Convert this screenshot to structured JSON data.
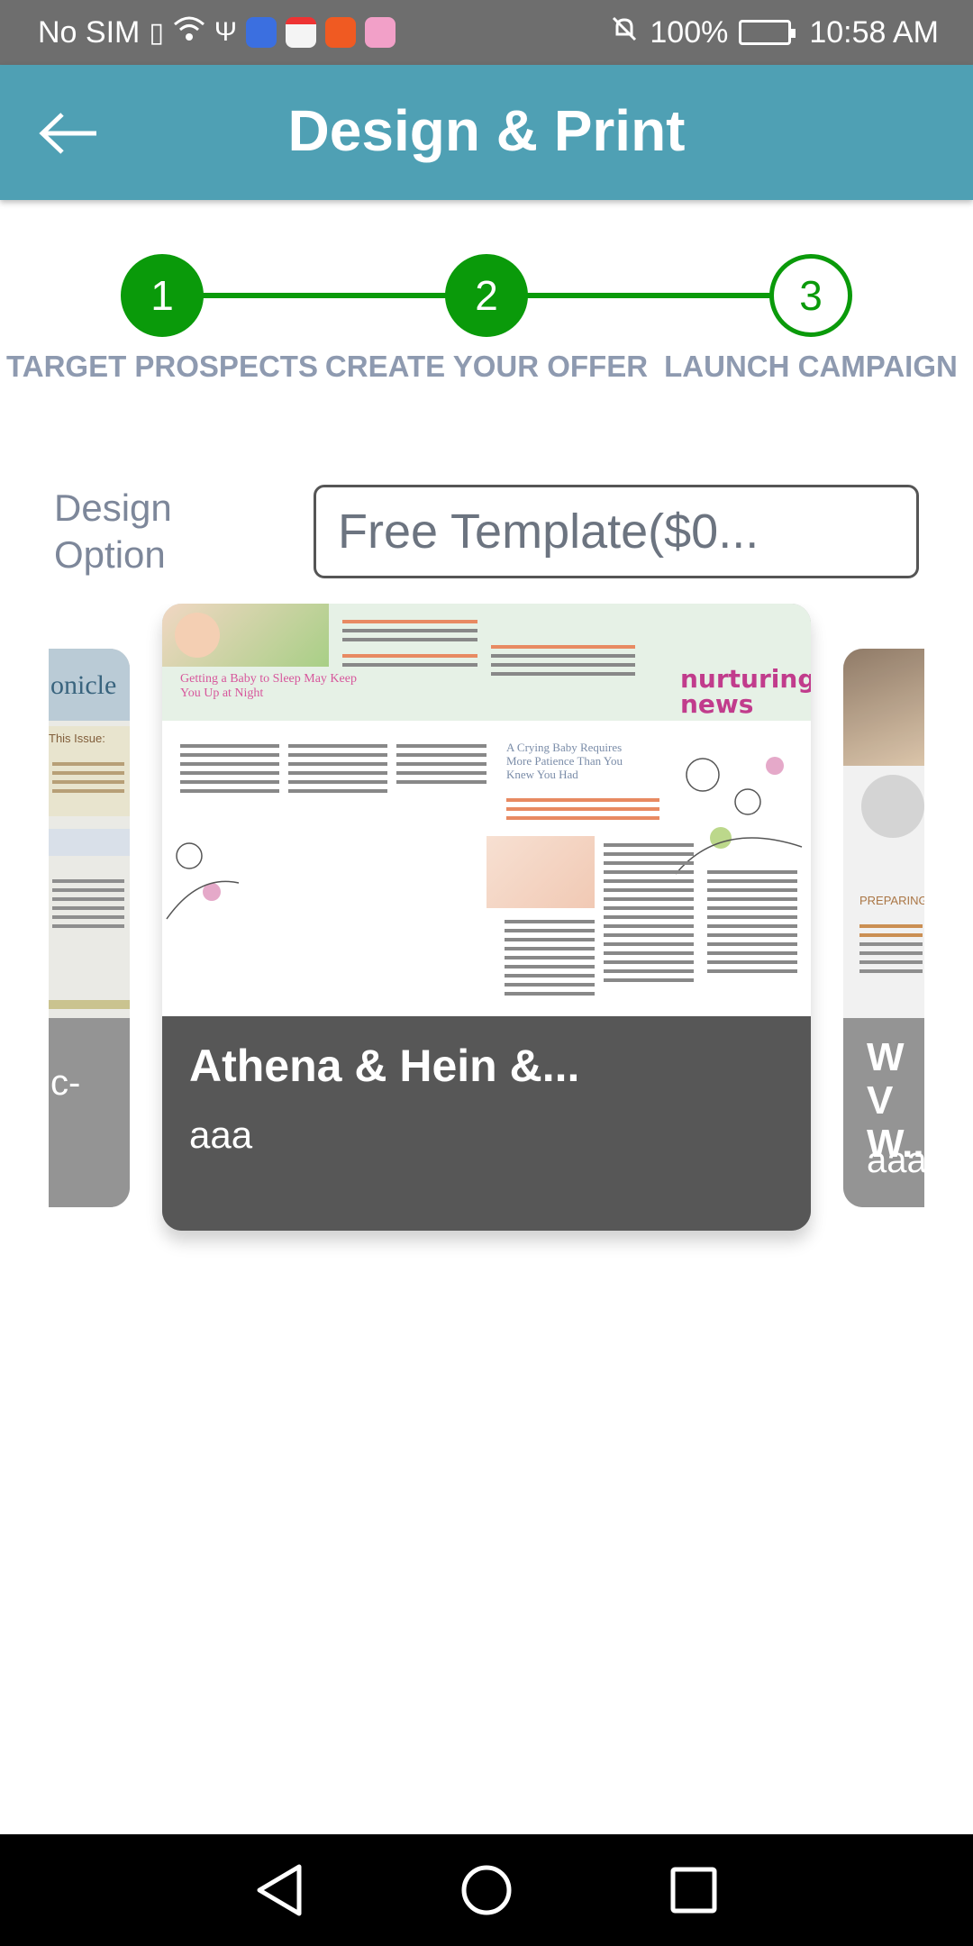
{
  "status_bar": {
    "carrier": "No SIM",
    "battery": "100%",
    "time": "10:58 AM"
  },
  "app_bar": {
    "title": "Design & Print"
  },
  "stepper": {
    "steps": [
      {
        "number": "1",
        "label": "TARGET PROSPECTS",
        "state": "done"
      },
      {
        "number": "2",
        "label": "CREATE YOUR OFFER",
        "state": "done"
      },
      {
        "number": "3",
        "label": "LAUNCH CAMPAIGN",
        "state": "current"
      }
    ]
  },
  "design_option": {
    "label_line1": "Design",
    "label_line2": "Option",
    "selected": "Free Template($0..."
  },
  "carousel": {
    "left_card": {
      "partial_title": "onicle",
      "partial_caption": "c-",
      "issue": "This Issue:"
    },
    "main_card": {
      "title": "Athena & Hein &...",
      "subtitle": "aaa",
      "thumb": {
        "headline_left": "Getting a Baby to Sleep May Keep You Up at Night",
        "headline_mid": "A Crying Baby Requires More Patience Than You Knew You Had",
        "brand_line1": "nurturing",
        "brand_line2": "news"
      }
    },
    "right_card": {
      "partial_title": "WV W...",
      "partial_caption": "aaa",
      "section": "PREPARING T"
    }
  },
  "colors": {
    "app_bar": "#4fa0b4",
    "step_green": "#0a9a0a",
    "step_label": "#8e9ab0",
    "card_caption": "#575757"
  }
}
